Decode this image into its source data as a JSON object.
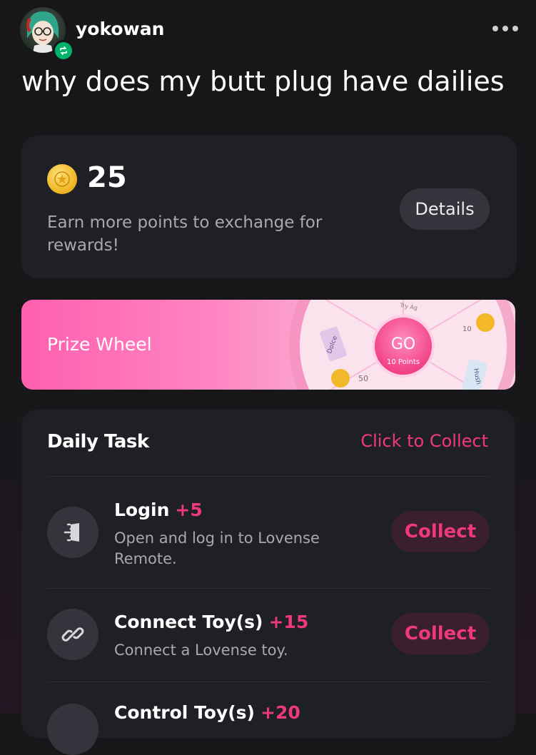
{
  "post": {
    "username": "yokowan",
    "text": "why does my butt plug have dailies"
  },
  "points": {
    "value": "25",
    "description": "Earn more points to exchange for rewards!",
    "details_label": "Details"
  },
  "prize_wheel": {
    "label": "Prize Wheel",
    "go_label": "GO",
    "go_cost": "10 Points",
    "segments": [
      "Dolce",
      "50",
      "10",
      "Hush",
      "Try Ag"
    ]
  },
  "daily_task": {
    "title": "Daily Task",
    "collect_all": "Click to Collect",
    "tasks": [
      {
        "name": "Login",
        "points": "+5",
        "description": "Open and log in to Lovense Remote.",
        "button": "Collect",
        "icon": "door-enter-icon"
      },
      {
        "name": "Connect Toy(s)",
        "points": "+15",
        "description": "Connect a Lovense toy.",
        "button": "Collect",
        "icon": "link-icon"
      },
      {
        "name": "Control Toy(s)",
        "points": "+20"
      }
    ]
  },
  "colors": {
    "background": "#17171a",
    "card": "#1f2026",
    "accent_pink": "#f0387f",
    "reblog_green": "#00b36b",
    "coin_gold": "#f2b82a"
  }
}
